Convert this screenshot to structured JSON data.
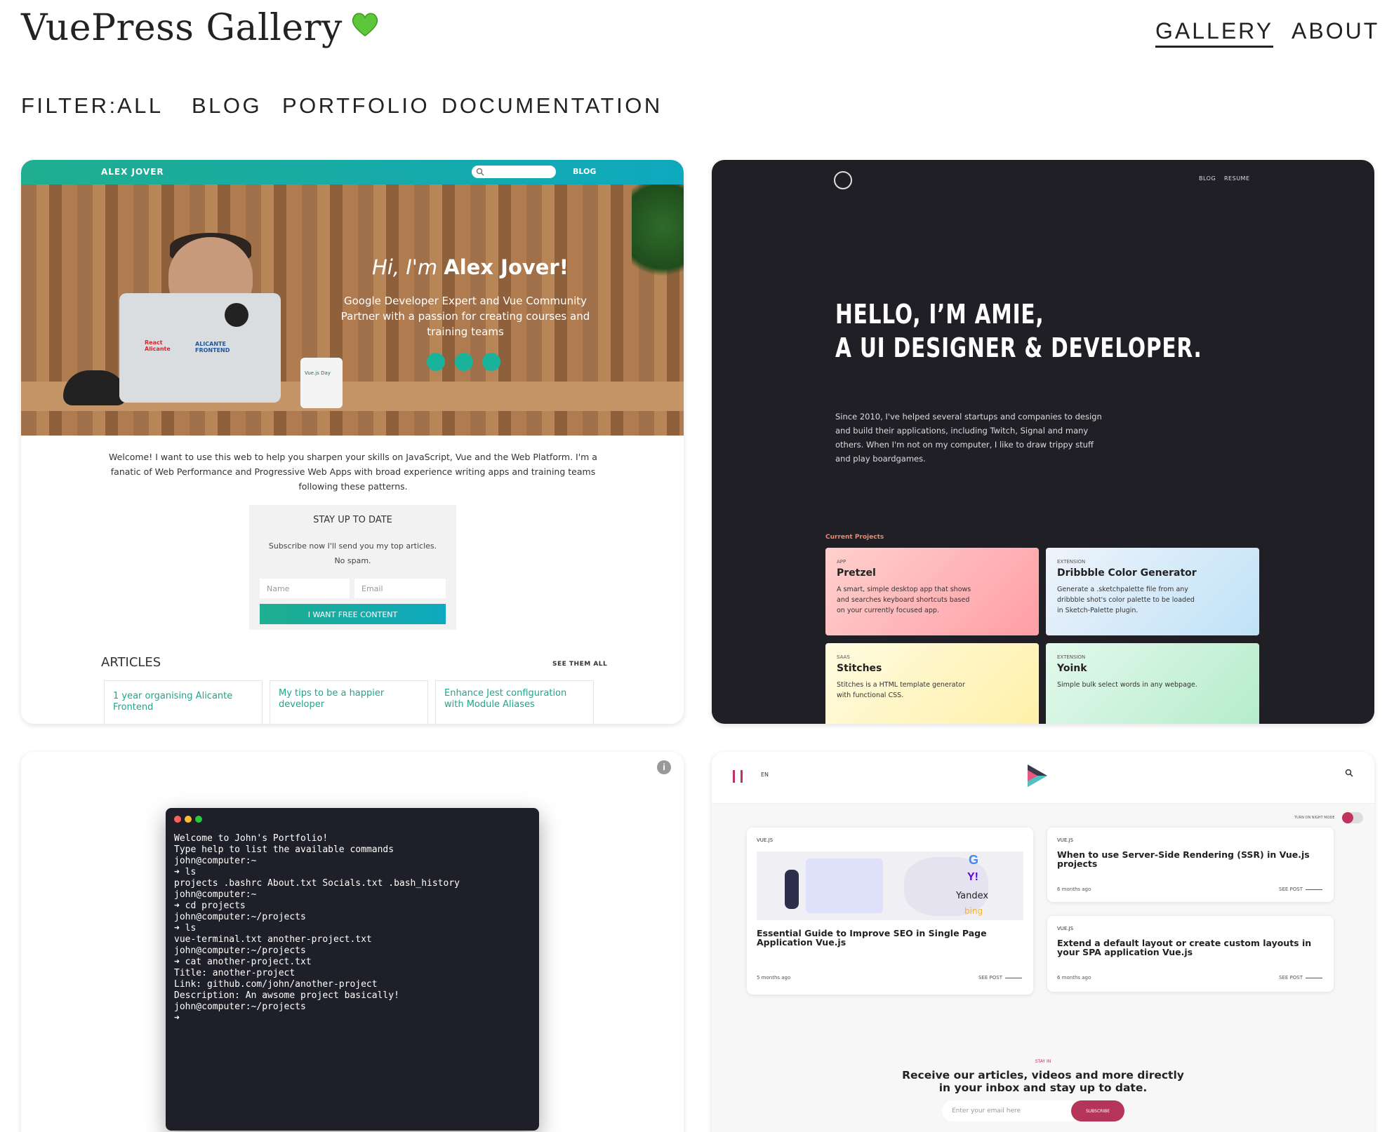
{
  "header": {
    "title": "VuePress Gallery",
    "heart_icon": "green-heart-icon",
    "nav": [
      {
        "label": "GALLERY",
        "active": true
      },
      {
        "label": "ABOUT",
        "active": false
      }
    ]
  },
  "filter": {
    "label": "FILTER:",
    "options": [
      "ALL",
      "BLOG",
      "PORTFOLIO",
      "DOCUMENTATION"
    ]
  },
  "cards": {
    "alex": {
      "brand": "ALEX JOVER",
      "nav_blog": "BLOG",
      "greeting_prefix": "Hi, I'm",
      "greeting_name": "Alex Jover!",
      "tagline": "Google Developer Expert and Vue Community Partner with a passion for creating courses and training teams",
      "intro": "Welcome! I want to use this web to help you sharpen your skills on JavaScript, Vue and the Web Platform. I'm a fanatic of Web Performance and Progressive Web Apps with broad experience writing apps and training teams following these patterns.",
      "subscribe_title": "STAY UP TO DATE",
      "subscribe_text": "Subscribe now I'll send you my top articles. No spam.",
      "name_placeholder": "Name",
      "email_placeholder": "Email",
      "cta": "I WANT FREE CONTENT",
      "articles_title": "ARTICLES",
      "see_all": "SEE THEM ALL",
      "articles": [
        "1 year organising Alicante Frontend",
        "My tips to be a happier developer",
        "Enhance Jest configuration with Module Aliases"
      ],
      "sticker_react": "React Alicante",
      "sticker_alicante": "ALICANTE FRONTEND",
      "mug_text": "Vue.js Day"
    },
    "amie": {
      "nav": [
        "BLOG",
        "RESUME"
      ],
      "headline_1": "HELLO, I’M AMIE,",
      "headline_2": "A UI DESIGNER & DEVELOPER.",
      "bio": "Since 2010, I've helped several startups and companies to design and build their applications, including Twitch, Signal and many others. When I'm not on my computer, I like to draw trippy stuff and play boardgames.",
      "projects_label": "Current Projects",
      "projects": [
        {
          "kind": "APP",
          "name": "Pretzel",
          "desc": "A smart, simple desktop app that shows and searches keyboard shortcuts based on your currently focused app.",
          "color": "#ffb3b8"
        },
        {
          "kind": "EXTENSION",
          "name": "Dribbble Color Generator",
          "desc": "Generate a .sketchpalette file from any dribbble shot's color palette to be loaded in Sketch-Palette plugin.",
          "color": "#cfe6f7"
        },
        {
          "kind": "SAAS",
          "name": "Stitches",
          "desc": "Stitches is a HTML template generator with functional CSS.",
          "color": "#fff6c2"
        },
        {
          "kind": "EXTENSION",
          "name": "Yoink",
          "desc": "Simple bulk select words in any webpage.",
          "color": "#c9f2d8"
        }
      ]
    },
    "terminal": {
      "lines": [
        "Welcome to John's Portfolio!",
        "",
        "Type help to list the available commands",
        "",
        "john@computer:~",
        "➜ ls",
        "projects .bashrc About.txt Socials.txt .bash_history",
        "",
        "john@computer:~",
        "➜ cd projects",
        "",
        "john@computer:~/projects",
        "➜ ls",
        "vue-terminal.txt another-project.txt",
        "",
        "john@computer:~/projects",
        "➜ cat another-project.txt",
        "Title: another-project",
        "Link: github.com/john/another-project",
        "Description: An awsome project basically!",
        "",
        "john@computer:~/projects",
        "➜"
      ]
    },
    "blog": {
      "lang": "EN",
      "night_mode": "TURN ON NIGHT MODE",
      "posts": [
        {
          "tag": "VUE.JS",
          "title": "Essential Guide to Improve SEO in Single Page Application Vue.js",
          "age": "5 months ago",
          "cta": "SEE POST"
        },
        {
          "tag": "VUE.JS",
          "title": "When to use Server-Side Rendering (SSR) in Vue.js projects",
          "age": "6 months ago",
          "cta": "SEE POST"
        },
        {
          "tag": "VUE.JS",
          "title": "Extend a default layout or create custom layouts in your SPA application Vue.js",
          "age": "6 months ago",
          "cta": "SEE POST"
        }
      ],
      "search_labels": [
        "Yandex",
        "bing"
      ],
      "stay_label": "STAY IN",
      "newsletter_1": "Receive our articles, videos and more directly",
      "newsletter_2": "in your inbox and stay up to date.",
      "email_placeholder": "Enter your email here",
      "subscribe": "SUBSCRIBE"
    }
  }
}
